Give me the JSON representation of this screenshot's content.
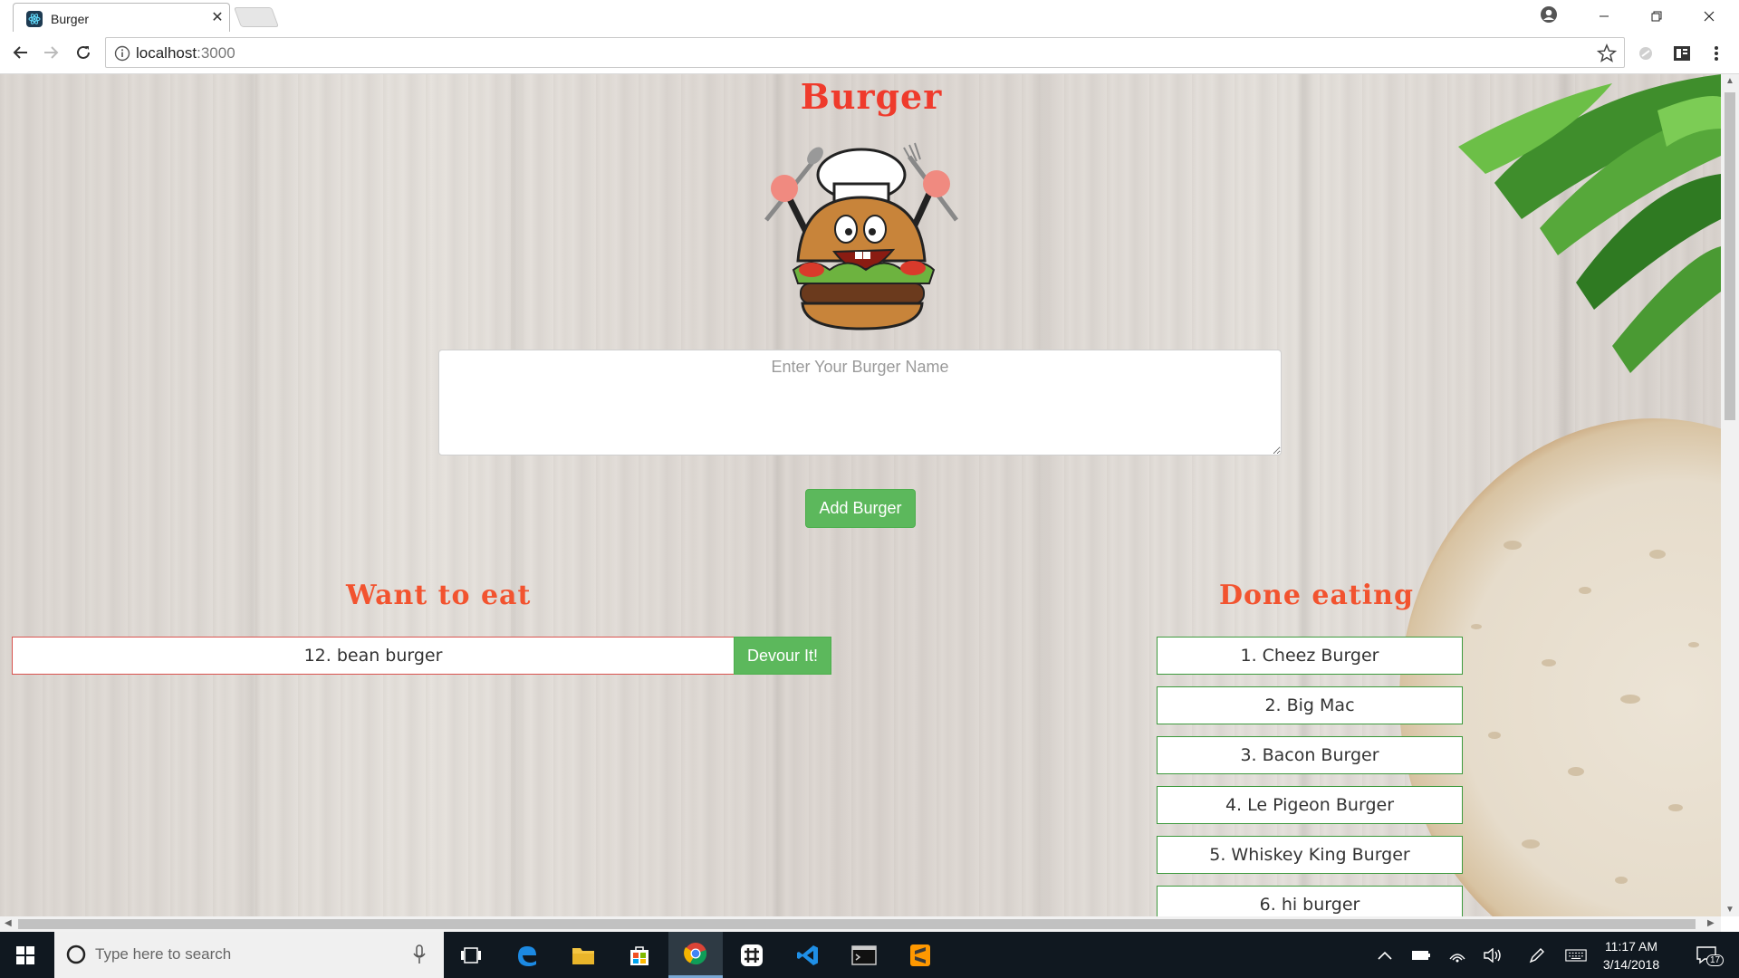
{
  "browser": {
    "tab_title": "Burger",
    "url_host": "localhost",
    "url_port": ":3000"
  },
  "page": {
    "title": "Burger",
    "input_placeholder": "Enter Your Burger Name",
    "add_button_label": "Add Burger",
    "want_heading": "Want to eat",
    "done_heading": "Done eating",
    "want_items": [
      {
        "label": "12. bean burger",
        "button_label": "Devour It!"
      }
    ],
    "done_items": [
      {
        "label": "1. Cheez Burger"
      },
      {
        "label": "2. Big Mac"
      },
      {
        "label": "3. Bacon Burger"
      },
      {
        "label": "4. Le Pigeon Burger"
      },
      {
        "label": "5. Whiskey King Burger"
      },
      {
        "label": "6. hi burger"
      }
    ]
  },
  "taskbar": {
    "search_placeholder": "Type here to search",
    "time": "11:17 AM",
    "date": "3/14/2018",
    "notification_count": "17"
  },
  "colors": {
    "heading_red": "#ef3b2c",
    "button_green": "#5cb85c",
    "want_border": "#d9534f",
    "done_border": "#3d9a3d"
  }
}
